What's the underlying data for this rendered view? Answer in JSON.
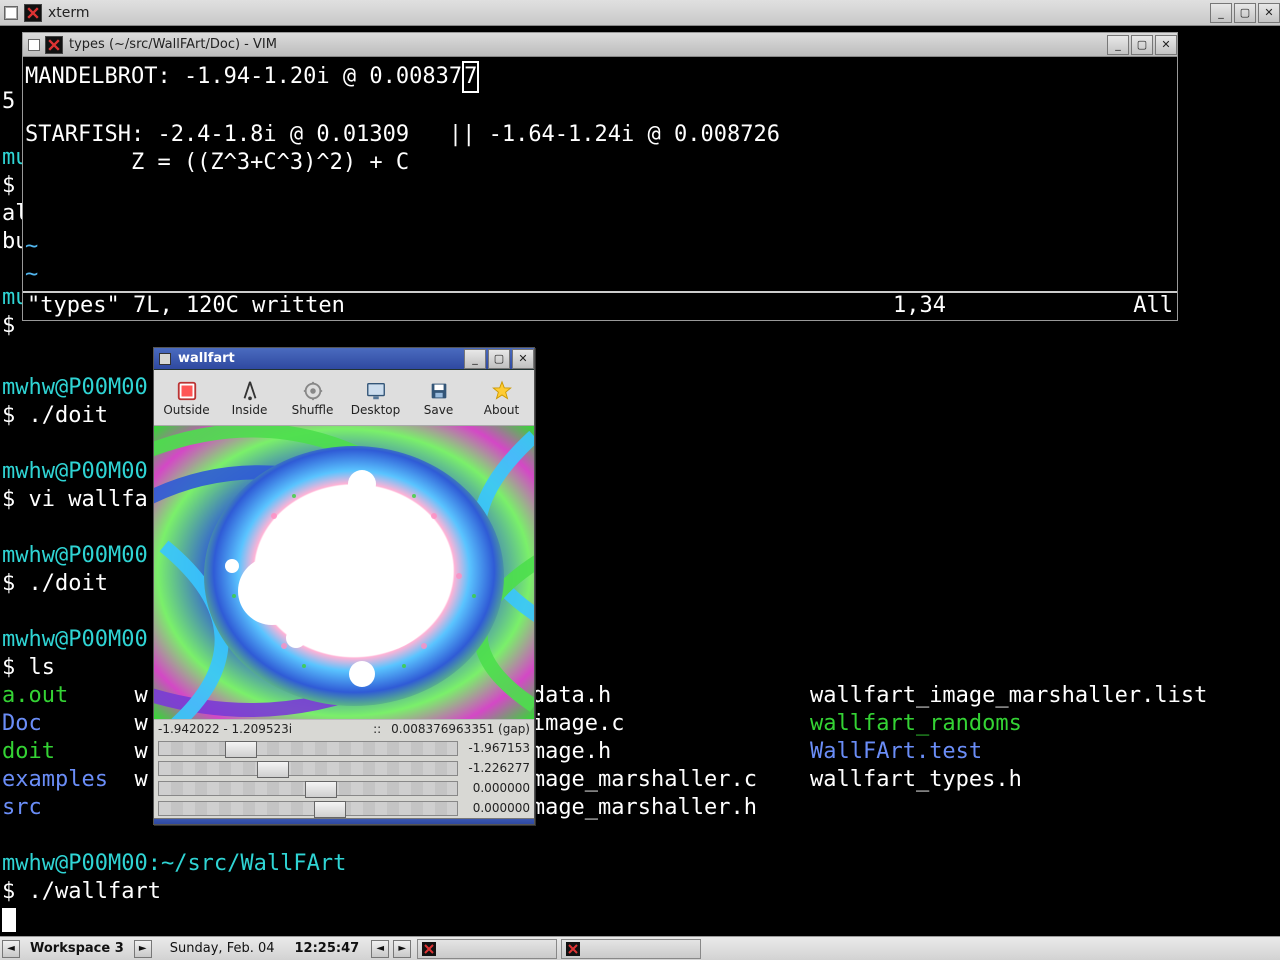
{
  "xterm": {
    "title": "xterm",
    "left_fragments": [
      "5",
      " ",
      "mu",
      "$ ",
      "al",
      "bu",
      "",
      "mu",
      "$"
    ]
  },
  "vim": {
    "title": "types (~/src/WallFArt/Doc) - VIM",
    "content": {
      "line1_pre": "MANDELBROT: -1.94-1.20i @ 0.00837",
      "line1_cursor": "7",
      "line2": "",
      "line3": "STARFISH: -2.4-1.8i @ 0.01309   || -1.64-1.24i @ 0.008726",
      "line4": "        Z = ((Z^3+C^3)^2) + C",
      "tilde1": "~",
      "tilde2": "~"
    },
    "status": {
      "msg": "\"types\" 7L, 120C written",
      "pos": "1,34",
      "all": "All"
    }
  },
  "terminal": {
    "prompt_host": "mwhw@P00M00",
    "prompt_path": ":~/src/WallFArt",
    "history": [
      {
        "host": "mwhw@P00M00",
        "cmd": "./doit"
      },
      {
        "host": "mwhw@P00M00",
        "cmd": "vi wallfa"
      },
      {
        "host": "mwhw@P00M00",
        "cmd": "./doit"
      },
      {
        "host": "mwhw@P00M00",
        "cmd": "ls"
      }
    ],
    "ls": {
      "col1": [
        {
          "t": "a.out",
          "c": "green"
        },
        {
          "t": "Doc",
          "c": "blue"
        },
        {
          "t": "doit",
          "c": "green"
        },
        {
          "t": "examples",
          "c": "blue"
        },
        {
          "t": "src",
          "c": "blue"
        }
      ],
      "col1b": [
        "w",
        "w",
        "w",
        "w",
        " "
      ],
      "col2": [
        {
          "t": "_data.h",
          "c": "white"
        },
        {
          "t": "_image.c",
          "c": "white"
        },
        {
          "t": "image.h",
          "c": "white"
        },
        {
          "t": "image_marshaller.c",
          "c": "white"
        },
        {
          "t": "image_marshaller.h",
          "c": "white"
        }
      ],
      "col3": [
        {
          "t": "wallfart_image_marshaller.list",
          "c": "white"
        },
        {
          "t": "wallfart_randoms",
          "c": "green"
        },
        {
          "t": "WallFArt.test",
          "c": "blue"
        },
        {
          "t": "wallfart_types.h",
          "c": "white"
        },
        {
          "t": "",
          "c": "white"
        }
      ]
    },
    "current": {
      "host": "mwhw@P00M00",
      "path": ":~/src/WallFArt",
      "cmd": "./wallfart"
    }
  },
  "wallfart": {
    "title": "wallfart",
    "toolbar": [
      {
        "name": "outside",
        "label": "Outside"
      },
      {
        "name": "inside",
        "label": "Inside"
      },
      {
        "name": "shuffle",
        "label": "Shuffle"
      },
      {
        "name": "desktop",
        "label": "Desktop"
      },
      {
        "name": "save",
        "label": "Save"
      },
      {
        "name": "about",
        "label": "About"
      }
    ],
    "coords": {
      "left": "-1.942022 - 1.209523i",
      "sep": "::",
      "right": "0.008376963351 (gap)"
    },
    "sliders": [
      {
        "val": "-1.967153",
        "thumb": 22
      },
      {
        "val": "-1.226277",
        "thumb": 33
      },
      {
        "val": "0.000000",
        "thumb": 49
      },
      {
        "val": "0.000000",
        "thumb": 52
      }
    ]
  },
  "taskbar": {
    "workspace": "Workspace 3",
    "date": "Sunday, Feb. 04",
    "time": "12:25:47"
  }
}
